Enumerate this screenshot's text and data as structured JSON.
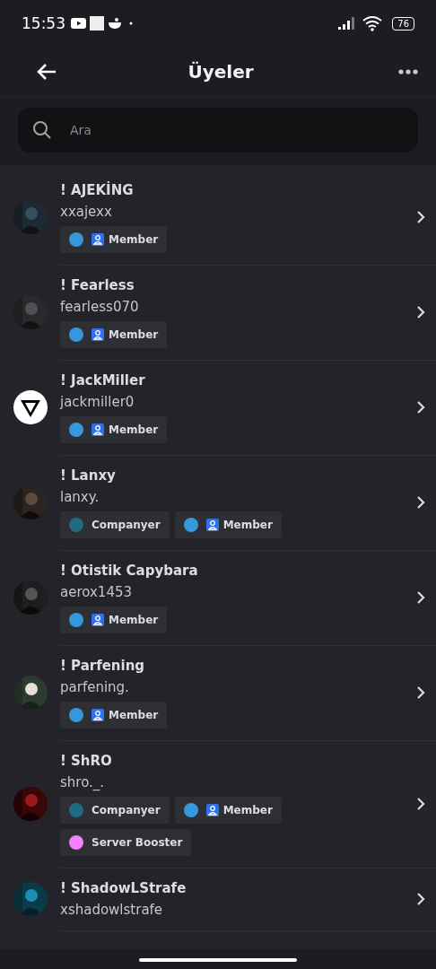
{
  "status_bar": {
    "time": "15:53",
    "battery": "76"
  },
  "header": {
    "title": "Üyeler"
  },
  "search": {
    "placeholder": "Ara"
  },
  "members": [
    {
      "name": "! AJEKİNG",
      "username": "xxajexx",
      "avatar": {
        "kind": "picture"
      },
      "roles": [
        {
          "label": "Member",
          "color": "#3498db",
          "kind": "badge"
        }
      ]
    },
    {
      "name": "! Fearless",
      "username": "fearless070",
      "avatar": {
        "kind": "picture"
      },
      "roles": [
        {
          "label": "Member",
          "color": "#3498db",
          "kind": "badge"
        }
      ]
    },
    {
      "name": "! JackMiller",
      "username": "jackmiller0",
      "avatar": {
        "kind": "logo"
      },
      "roles": [
        {
          "label": "Member",
          "color": "#3498db",
          "kind": "badge"
        }
      ]
    },
    {
      "name": "! Lanxy",
      "username": "lanxy.",
      "avatar": {
        "kind": "picture"
      },
      "roles": [
        {
          "label": "Companyer",
          "color": "#1f6b80",
          "kind": "plain"
        },
        {
          "label": "Member",
          "color": "#3498db",
          "kind": "badge"
        }
      ]
    },
    {
      "name": "! Otistik Capybara",
      "username": "aerox1453",
      "avatar": {
        "kind": "picture"
      },
      "roles": [
        {
          "label": "Member",
          "color": "#3498db",
          "kind": "badge"
        }
      ]
    },
    {
      "name": "! Parfening",
      "username": "parfening.",
      "avatar": {
        "kind": "picture"
      },
      "roles": [
        {
          "label": "Member",
          "color": "#3498db",
          "kind": "badge"
        }
      ]
    },
    {
      "name": "! ShRO",
      "username": "shro._.",
      "avatar": {
        "kind": "picture"
      },
      "roles": [
        {
          "label": "Companyer",
          "color": "#1f6b80",
          "kind": "plain"
        },
        {
          "label": "Member",
          "color": "#3498db",
          "kind": "badge"
        },
        {
          "label": "Server Booster",
          "color": "#f47fff",
          "kind": "plain"
        }
      ]
    },
    {
      "name": "! ShadowLStrafe",
      "username": "xshadowlstrafe",
      "avatar": {
        "kind": "picture"
      }
    }
  ]
}
